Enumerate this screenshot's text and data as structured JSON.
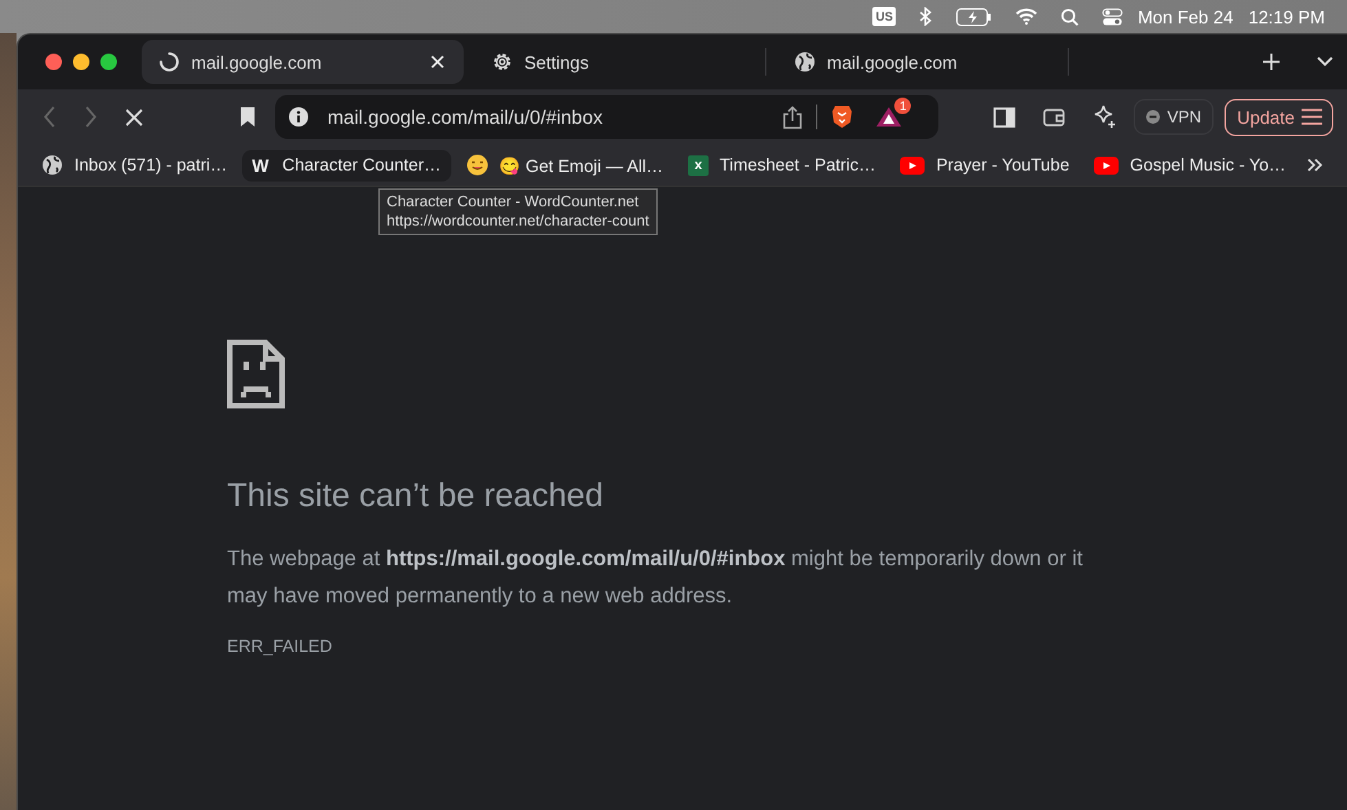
{
  "menu_bar": {
    "input_source": "US",
    "date": "Mon Feb 24",
    "time": "12:19 PM"
  },
  "tabs": [
    {
      "title": "mail.google.com",
      "kind": "loading",
      "selected": true
    },
    {
      "title": "Settings",
      "kind": "settings",
      "selected": false
    },
    {
      "title": "mail.google.com",
      "kind": "web",
      "selected": false
    }
  ],
  "toolbar": {
    "address": "mail.google.com/mail/u/0/#inbox",
    "rewards_badge": "1",
    "vpn": "VPN",
    "update": "Update"
  },
  "bookmarks": [
    {
      "title": "Inbox (571) - patri…",
      "kind": "web",
      "selected": false
    },
    {
      "title": "Character Counter…",
      "kind": "letter",
      "icon_text": "W",
      "selected": true
    },
    {
      "title": "😋 Get Emoji — All…",
      "kind": "emoji",
      "selected": false
    },
    {
      "title": "Timesheet - Patric…",
      "kind": "sheet",
      "icon_text": "x",
      "selected": false
    },
    {
      "title": "Prayer - YouTube",
      "kind": "video",
      "selected": false
    },
    {
      "title": "Gospel Music - Yo…",
      "kind": "video",
      "selected": false
    }
  ],
  "tooltip": {
    "title": "Character Counter - WordCounter.net",
    "url": "https://wordcounter.net/character-count"
  },
  "error_page": {
    "heading": "This site can’t be reached",
    "message": "The webpage at **https://mail.google.com/mail/u/0/#inbox** might be temporarily down or it may have moved permanently to a new web address.",
    "code": "ERR_FAILED"
  }
}
